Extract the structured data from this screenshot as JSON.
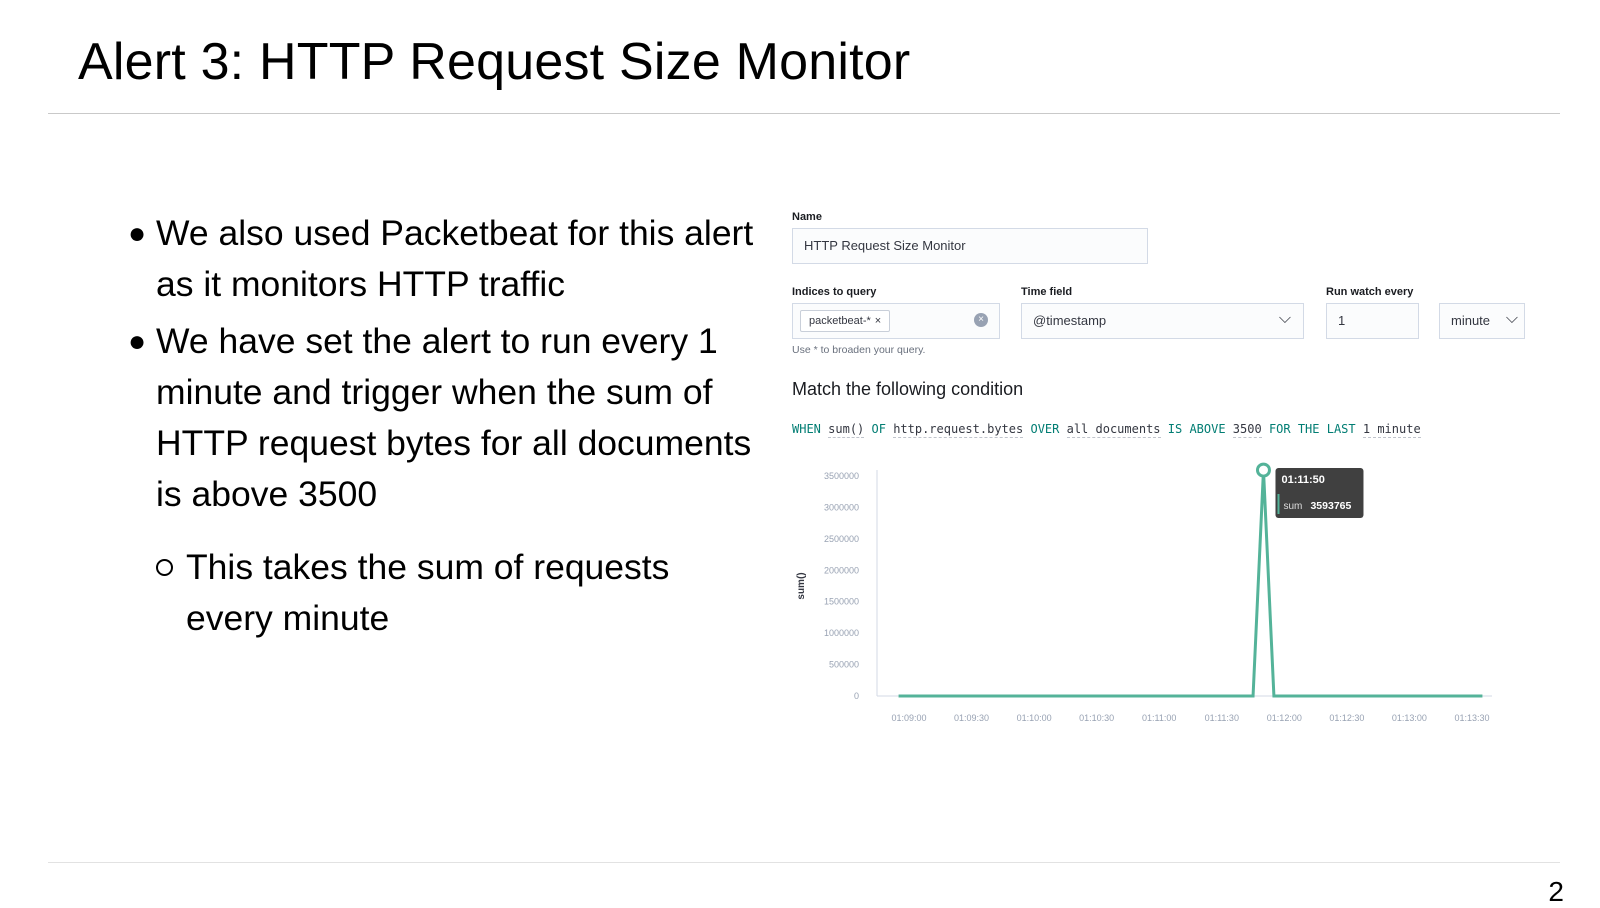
{
  "slide": {
    "title": "Alert 3: HTTP Request Size Monitor",
    "page_number": "2"
  },
  "bullets": [
    {
      "marker": "●",
      "text": "We also used Packetbeat for this alert as it monitors HTTP traffic"
    },
    {
      "marker": "●",
      "text": "We have set the alert to run every 1 minute and trigger when the sum of HTTP request bytes for all documents is above 3500"
    }
  ],
  "sub_bullet": {
    "text": "This takes the sum of requests every minute"
  },
  "form": {
    "name_label": "Name",
    "name_value": "HTTP Request Size Monitor",
    "indices_label": "Indices to query",
    "index_chip": "packetbeat-*",
    "chip_remove": "×",
    "clear_icon": "×",
    "indices_help": "Use * to broaden your query.",
    "time_field_label": "Time field",
    "time_field_value": "@timestamp",
    "run_every_label": "Run watch every",
    "run_every_value": "1",
    "run_every_unit": "minute",
    "chevron": "⌵"
  },
  "condition": {
    "heading": "Match the following condition",
    "when": "WHEN",
    "agg": "sum()",
    "of": "OF",
    "field": "http.request.bytes",
    "over": "OVER",
    "scope": "all documents",
    "threshold_cmp": "IS ABOVE",
    "threshold": "3500",
    "for_the_last": "FOR THE LAST",
    "window": "1 minute"
  },
  "chart_data": {
    "type": "line",
    "ylabel": "sum()",
    "ylim": [
      0,
      3500000
    ],
    "y_ticks": [
      "3500000",
      "3000000",
      "2500000",
      "2000000",
      "1500000",
      "1000000",
      "500000",
      "0"
    ],
    "x_ticks": [
      "01:09:00",
      "01:09:30",
      "01:10:00",
      "01:10:30",
      "01:11:00",
      "01:11:30",
      "01:12:00",
      "01:12:30",
      "01:13:00",
      "01:13:30"
    ],
    "series": [
      {
        "color": "#54b399",
        "points": [
          {
            "x": "01:08:55",
            "y": 0
          },
          {
            "x": "01:11:45",
            "y": 0
          },
          {
            "x": "01:11:50",
            "y": 3593765
          },
          {
            "x": "01:11:55",
            "y": 0
          },
          {
            "x": "01:13:35",
            "y": 0
          }
        ]
      }
    ],
    "tooltip": {
      "time": "01:11:50",
      "series": "sum",
      "value": "3593765"
    }
  }
}
